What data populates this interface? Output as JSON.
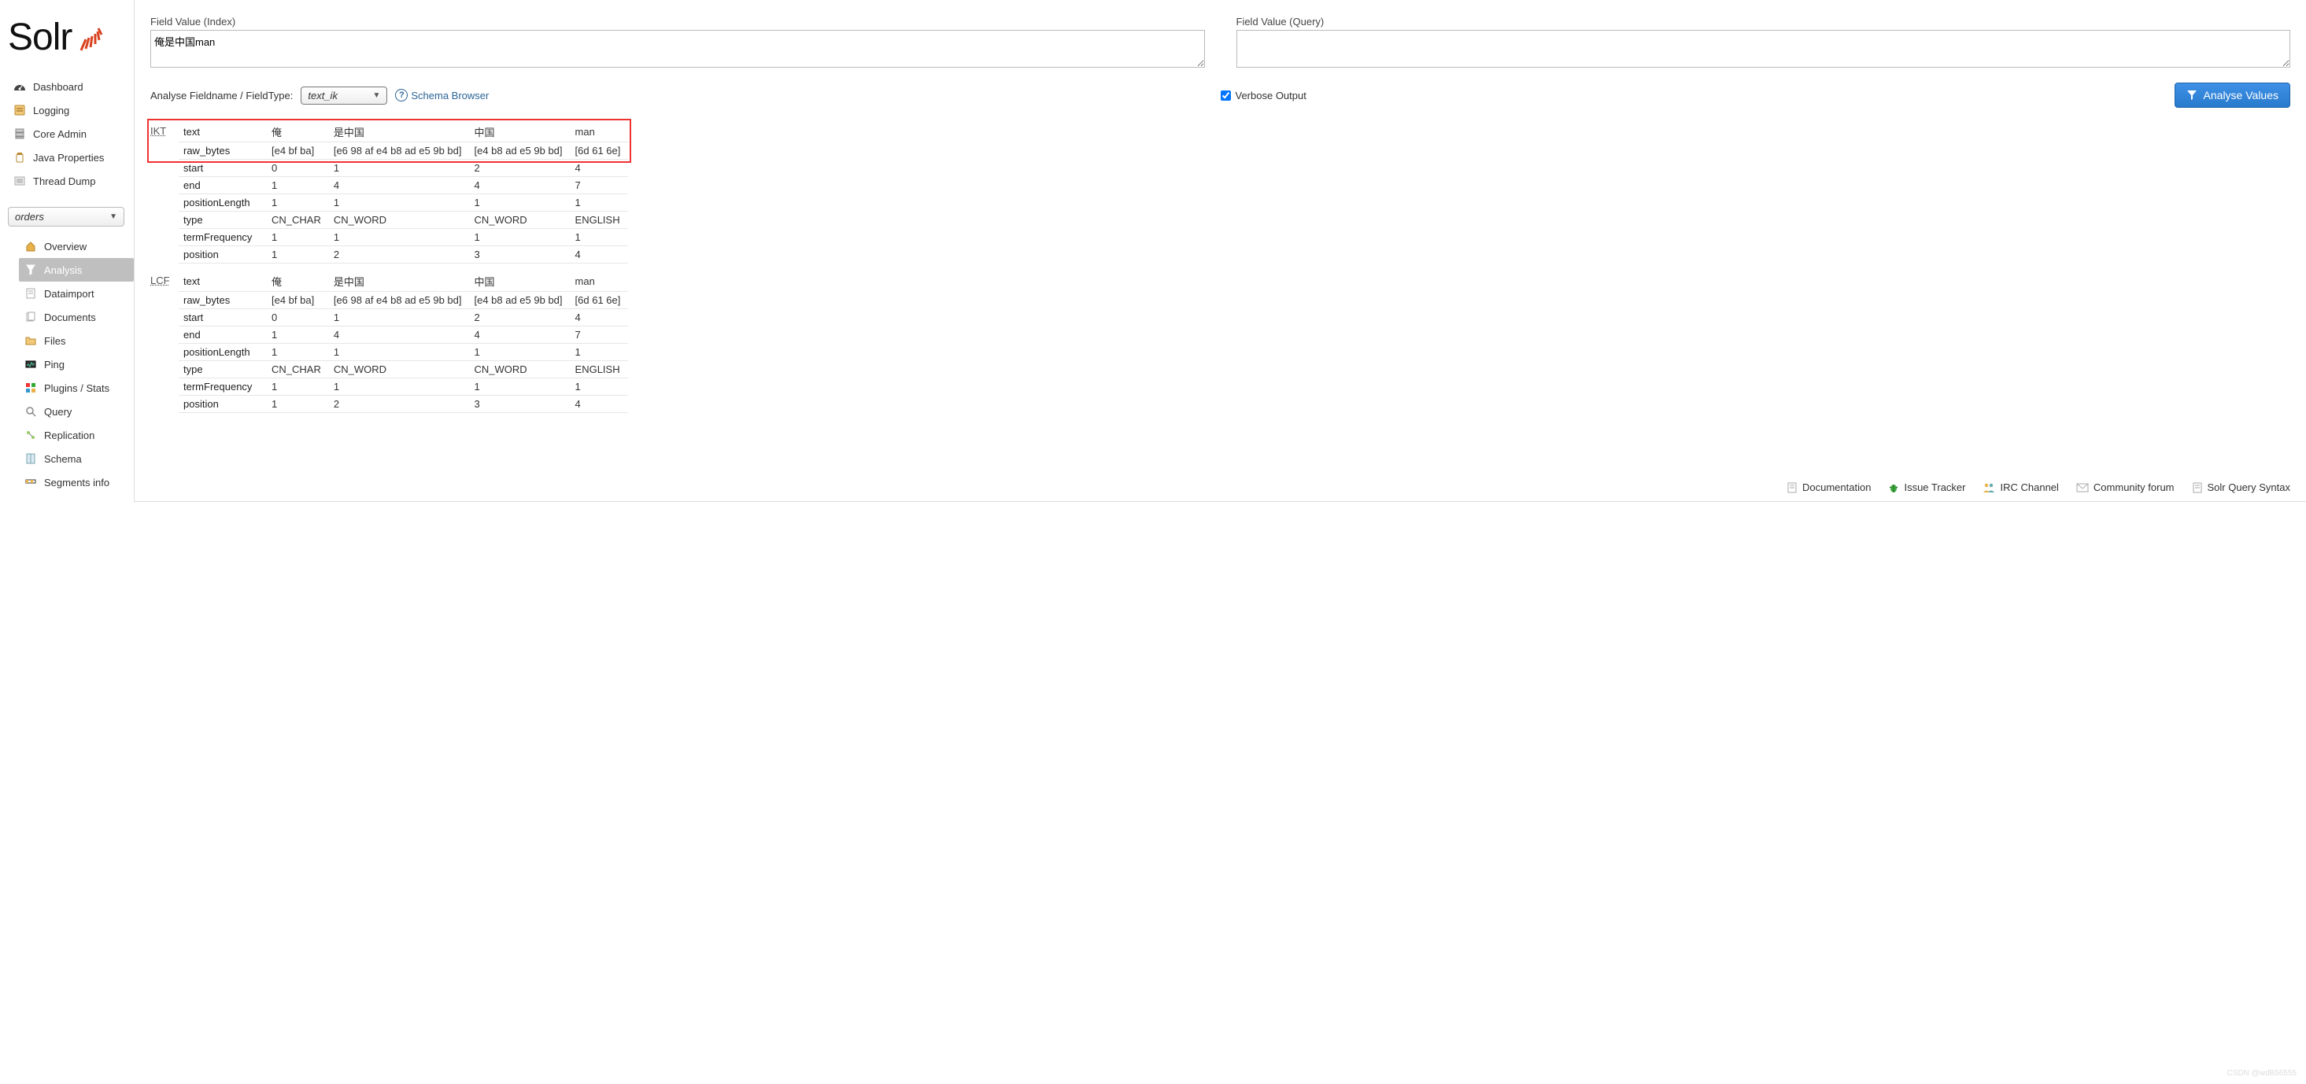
{
  "logo_text": "Solr",
  "nav": [
    {
      "label": "Dashboard"
    },
    {
      "label": "Logging"
    },
    {
      "label": "Core Admin"
    },
    {
      "label": "Java Properties"
    },
    {
      "label": "Thread Dump"
    }
  ],
  "core_select": {
    "selected": "orders"
  },
  "subnav": [
    {
      "label": "Overview"
    },
    {
      "label": "Analysis",
      "active": true
    },
    {
      "label": "Dataimport"
    },
    {
      "label": "Documents"
    },
    {
      "label": "Files"
    },
    {
      "label": "Ping"
    },
    {
      "label": "Plugins / Stats"
    },
    {
      "label": "Query"
    },
    {
      "label": "Replication"
    },
    {
      "label": "Schema"
    },
    {
      "label": "Segments info"
    }
  ],
  "form": {
    "index_label": "Field Value (Index)",
    "index_value": "俺是中国man",
    "query_label": "Field Value (Query)",
    "query_value": "",
    "analyse_label": "Analyse Fieldname / FieldType:",
    "fieldtype": "text_ik",
    "schema_browser": "Schema Browser",
    "verbose_label": "Verbose Output",
    "verbose_checked": true,
    "button": "Analyse Values"
  },
  "stages": [
    {
      "tag": "IKT",
      "highlight": 2,
      "row_labels": [
        "text",
        "raw_bytes",
        "start",
        "end",
        "positionLength",
        "type",
        "termFrequency",
        "position"
      ],
      "tokens": [
        {
          "text": "俺",
          "raw_bytes": "[e4 bf ba]",
          "start": "0",
          "end": "1",
          "positionLength": "1",
          "type": "CN_CHAR",
          "termFrequency": "1",
          "position": "1"
        },
        {
          "text": "是中国",
          "raw_bytes": "[e6 98 af e4 b8 ad e5 9b bd]",
          "start": "1",
          "end": "4",
          "positionLength": "1",
          "type": "CN_WORD",
          "termFrequency": "1",
          "position": "2"
        },
        {
          "text": "中国",
          "raw_bytes": "[e4 b8 ad e5 9b bd]",
          "start": "2",
          "end": "4",
          "positionLength": "1",
          "type": "CN_WORD",
          "termFrequency": "1",
          "position": "3"
        },
        {
          "text": "man",
          "raw_bytes": "[6d 61 6e]",
          "start": "4",
          "end": "7",
          "positionLength": "1",
          "type": "ENGLISH",
          "termFrequency": "1",
          "position": "4"
        }
      ]
    },
    {
      "tag": "LCF",
      "highlight": 0,
      "row_labels": [
        "text",
        "raw_bytes",
        "start",
        "end",
        "positionLength",
        "type",
        "termFrequency",
        "position"
      ],
      "tokens": [
        {
          "text": "俺",
          "raw_bytes": "[e4 bf ba]",
          "start": "0",
          "end": "1",
          "positionLength": "1",
          "type": "CN_CHAR",
          "termFrequency": "1",
          "position": "1"
        },
        {
          "text": "是中国",
          "raw_bytes": "[e6 98 af e4 b8 ad e5 9b bd]",
          "start": "1",
          "end": "4",
          "positionLength": "1",
          "type": "CN_WORD",
          "termFrequency": "1",
          "position": "2"
        },
        {
          "text": "中国",
          "raw_bytes": "[e4 b8 ad e5 9b bd]",
          "start": "2",
          "end": "4",
          "positionLength": "1",
          "type": "CN_WORD",
          "termFrequency": "1",
          "position": "3"
        },
        {
          "text": "man",
          "raw_bytes": "[6d 61 6e]",
          "start": "4",
          "end": "7",
          "positionLength": "1",
          "type": "ENGLISH",
          "termFrequency": "1",
          "position": "4"
        }
      ]
    }
  ],
  "footer": [
    {
      "label": "Documentation"
    },
    {
      "label": "Issue Tracker"
    },
    {
      "label": "IRC Channel"
    },
    {
      "label": "Community forum"
    },
    {
      "label": "Solr Query Syntax"
    }
  ],
  "watermark": "CSDN @wdB56555"
}
